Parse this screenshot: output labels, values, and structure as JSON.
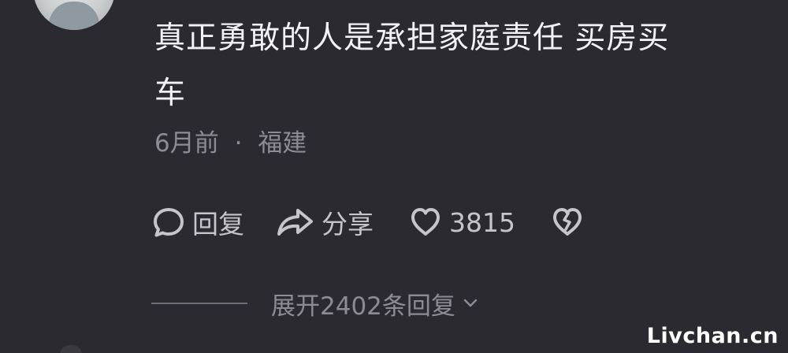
{
  "comment": {
    "text_line1": "真正勇敢的人是承担家庭责任 买房买",
    "text_line2": "车",
    "time": "6月前",
    "separator": "·",
    "location": "福建"
  },
  "actions": {
    "reply_label": "回复",
    "share_label": "分享",
    "like_count": "3815"
  },
  "expand": {
    "label": "展开2402条回复"
  },
  "watermark": "Livchan.cn",
  "colors": {
    "background": "#2b2a31",
    "text_primary": "#f2f1f5",
    "text_secondary": "#8d8c95",
    "icon": "#c6c5cc"
  },
  "icons": {
    "reply": "speech-bubble-icon",
    "share": "share-arrow-icon",
    "like": "heart-outline-icon",
    "dislike": "broken-heart-icon",
    "expand": "chevron-down-icon"
  }
}
